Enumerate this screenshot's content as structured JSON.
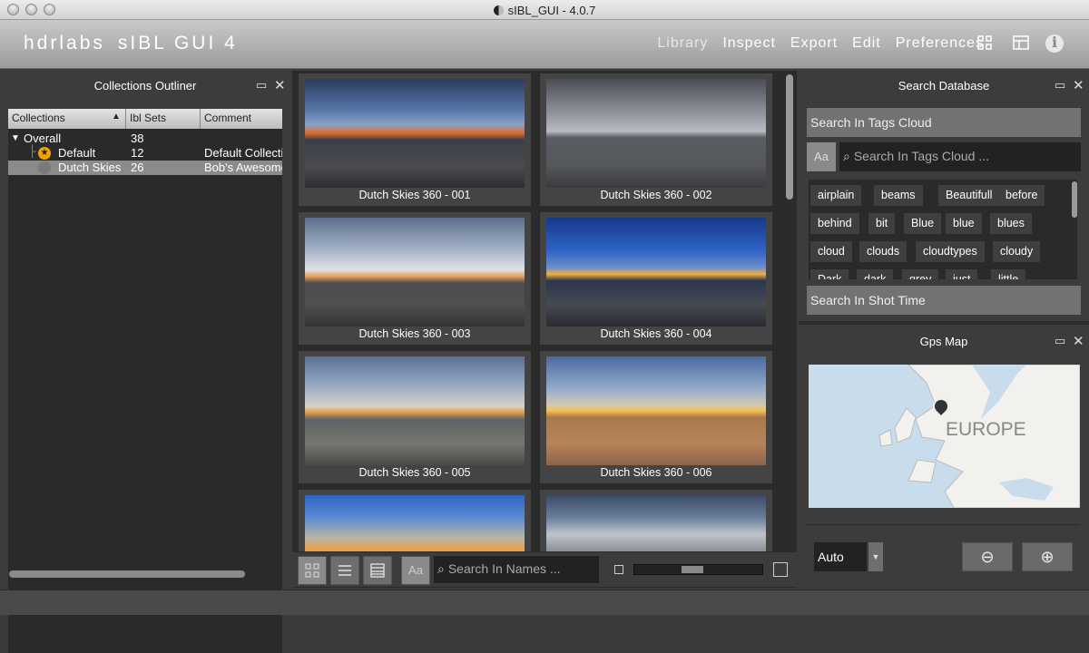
{
  "window": {
    "title": "sIBL_GUI - 4.0.7"
  },
  "header": {
    "logo_left": "hdrlabs",
    "logo_right": "sIBL GUI  4",
    "menu": [
      "Library",
      "Inspect",
      "Export",
      "Edit",
      "Preferences"
    ],
    "active_menu": "Library",
    "icons": [
      "grid-layout-icon",
      "panel-layout-icon",
      "info-icon"
    ]
  },
  "collections": {
    "title": "Collections Outliner",
    "columns": [
      "Collections",
      "Ibl Sets",
      "Comment"
    ],
    "rows": [
      {
        "name": "Overall",
        "count": "38",
        "comment": ""
      },
      {
        "name": "Default",
        "count": "12",
        "comment": "Default Collection"
      },
      {
        "name": "Dutch Skies",
        "count": "26",
        "comment": "Bob's Awesome"
      }
    ]
  },
  "library": {
    "thumbnails": [
      "Dutch Skies 360 - 001",
      "Dutch Skies 360 - 002",
      "Dutch Skies 360 - 003",
      "Dutch Skies 360 - 004",
      "Dutch Skies 360 - 005",
      "Dutch Skies 360 - 006",
      "",
      ""
    ],
    "search_placeholder": "Search In Names ...",
    "case_label": "Aa"
  },
  "search": {
    "title": "Search Database",
    "tags_section": "Search In Tags Cloud",
    "case_label": "Aa",
    "tags_placeholder": "Search In Tags Cloud ...",
    "tags": [
      "airplain",
      "beams",
      "Beautifull",
      "before",
      "behind",
      "bit",
      "Blue",
      "blue",
      "blues",
      "cloud",
      "clouds",
      "cloudtypes",
      "cloudy",
      "Dark",
      "dark",
      "grey",
      "just",
      "little"
    ],
    "shot_time_section": "Search In Shot Time"
  },
  "gps": {
    "title": "Gps Map",
    "map_label": "EUROPE",
    "map_type": "Auto",
    "zoom_out": "⊖",
    "zoom_in": "⊕"
  },
  "colors": {
    "accent": "#f0a400",
    "panel": "#3c3c3c",
    "dark": "#2a2a2a"
  }
}
